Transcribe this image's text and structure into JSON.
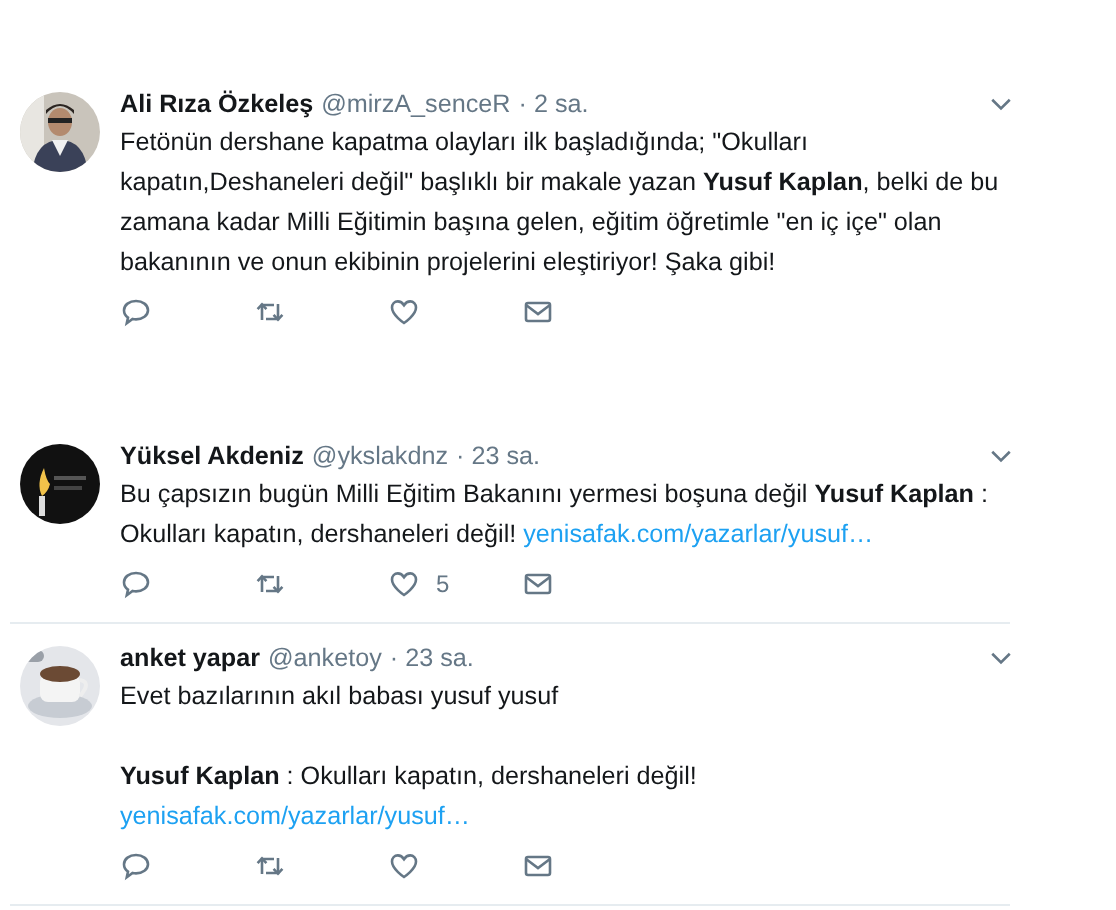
{
  "tweets": [
    {
      "name": "Ali Rıza Özkeleş",
      "handle": "@mirzA_senceR",
      "time": "· 2 sa.",
      "avatar": {
        "kind": "picture"
      },
      "paragraphs": [
        {
          "text": "Fetönün dershane kapatma olayları ilk başladığında; \"Okulları kapatın,Deshaneleri değil\" başlıklı bir makale yazan **Yusuf Kaplan**, belki de bu zamana kadar Milli Eğitimin başına gelen, eğitim öğretimle \"en iç içe\" olan bakanının ve onun ekibinin  projelerini eleştiriyor! Şaka gibi!"
        }
      ],
      "actions": [
        {
          "kind": "reply"
        },
        {
          "kind": "retweet"
        },
        {
          "kind": "like"
        },
        {
          "kind": "message"
        }
      ],
      "divider": false
    },
    {
      "name": "Yüksel Akdeniz",
      "handle": "@ykslakdnz",
      "time": "· 23 sa.",
      "avatar": {
        "kind": "picture"
      },
      "paragraphs": [
        {
          "text": "Bu çapsızın bugün Milli Eğitim Bakanını yermesi boşuna değil **Yusuf Kaplan** : Okulları kapatın, dershaneleri değil!",
          "link": "yenisafak.com/yazarlar/yusuf…"
        }
      ],
      "actions": [
        {
          "kind": "reply"
        },
        {
          "kind": "retweet"
        },
        {
          "kind": "like",
          "count": "5"
        },
        {
          "kind": "message"
        }
      ],
      "divider": true
    },
    {
      "name": "anket yapar",
      "handle": "@anketoy",
      "time": "· 23 sa.",
      "avatar": {
        "kind": "picture"
      },
      "paragraphs": [
        {
          "text": "Evet bazılarının akıl babası yusuf yusuf"
        },
        {
          "text": "**Yusuf Kaplan** : Okulları kapatın, dershaneleri değil!",
          "link": "yenisafak.com/yazarlar/yusuf…"
        }
      ],
      "actions": [
        {
          "kind": "reply"
        },
        {
          "kind": "retweet"
        },
        {
          "kind": "like"
        },
        {
          "kind": "message"
        }
      ],
      "divider": true
    }
  ]
}
